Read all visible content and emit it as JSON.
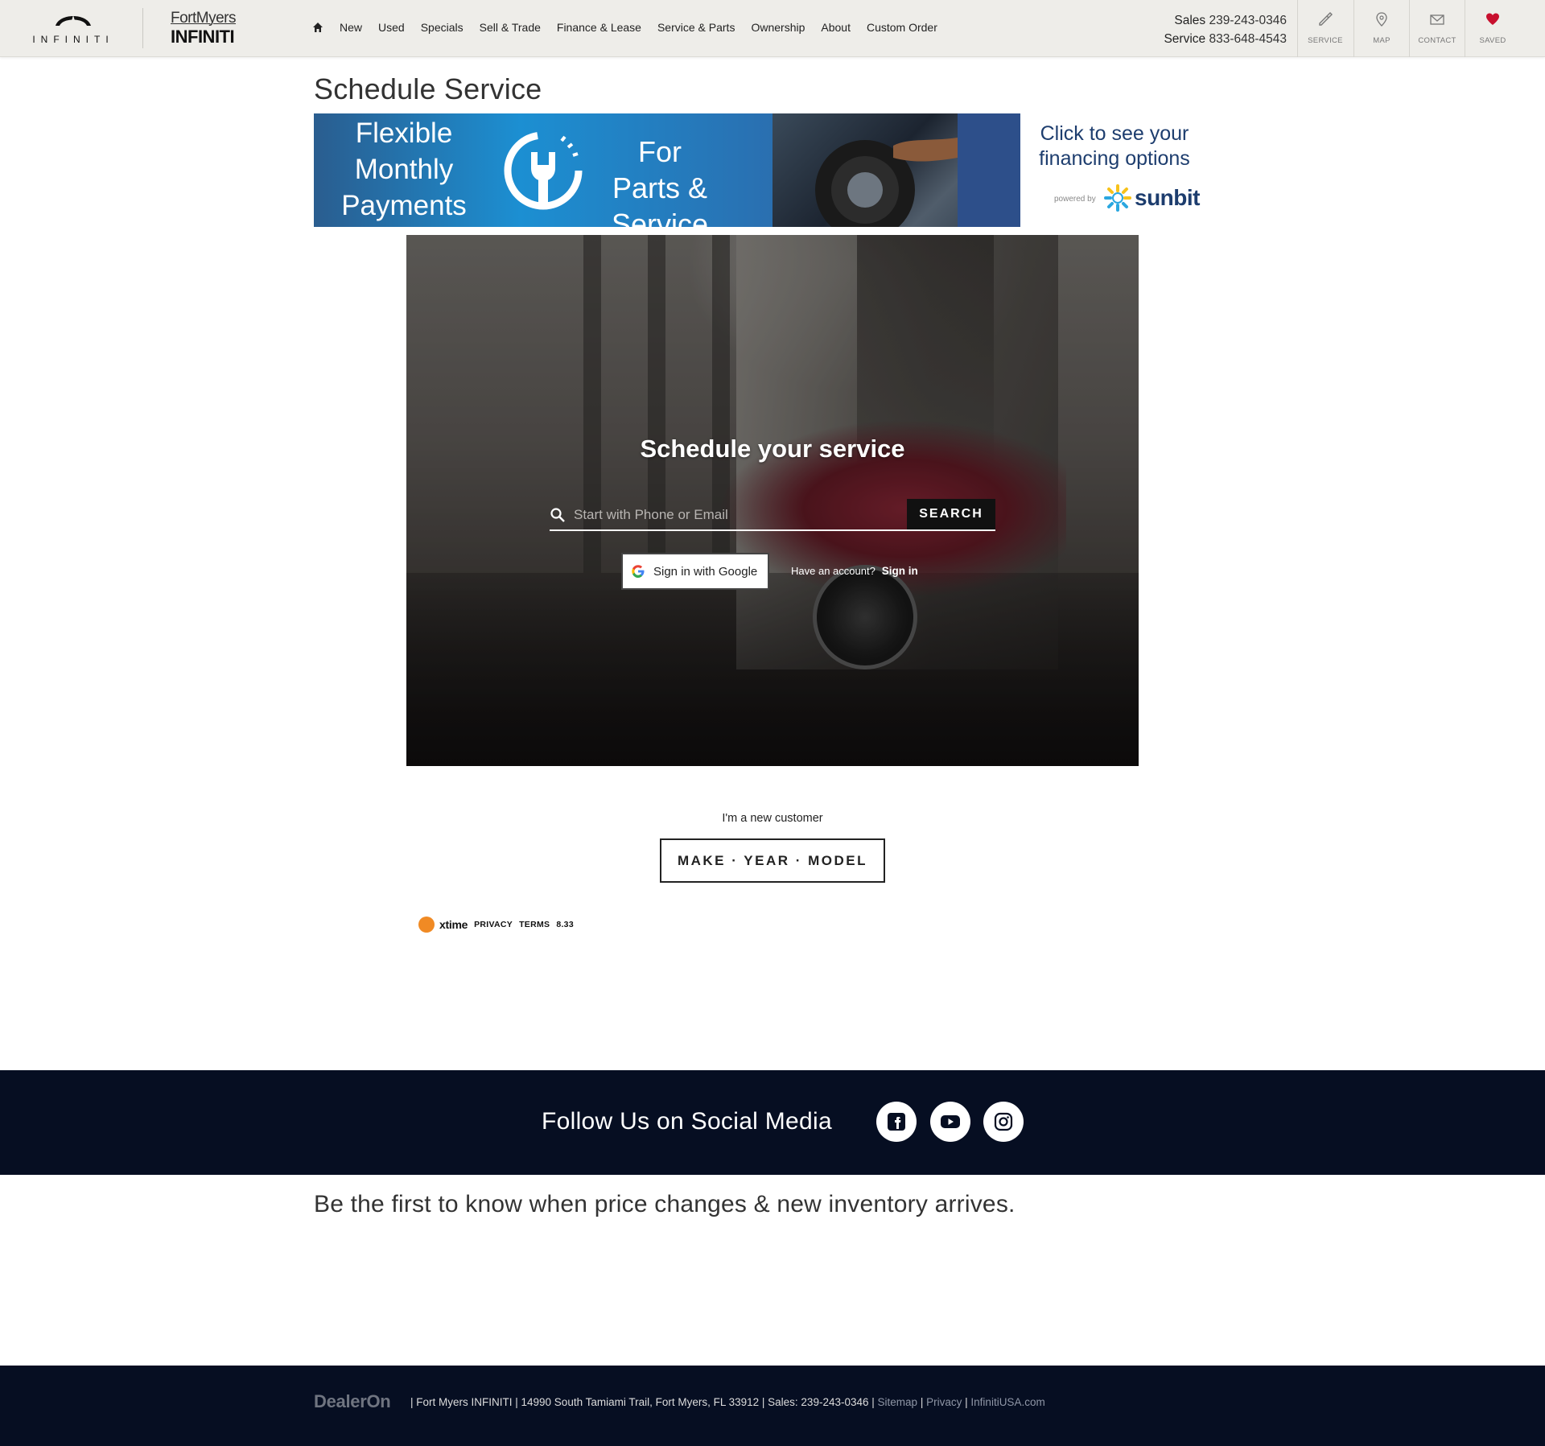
{
  "header": {
    "brand_word": "INFINITI",
    "dealer_line1": "FortMyers",
    "dealer_line2": "INFINITI",
    "nav": [
      "New",
      "Used",
      "Specials",
      "Sell & Trade",
      "Finance & Lease",
      "Service & Parts",
      "Ownership",
      "About",
      "Custom Order"
    ],
    "sales_label": "Sales",
    "sales_phone": "239-243-0346",
    "service_label": "Service",
    "service_phone": "833-648-4543",
    "utility": {
      "service": "SERVICE",
      "map": "MAP",
      "contact": "CONTACT",
      "saved": "SAVED"
    },
    "saved_color": "#c8102e"
  },
  "page": {
    "title": "Schedule Service"
  },
  "banner": {
    "left_text": "Flexible Monthly Payments",
    "mid_text": "For Parts & Service",
    "right_text": "Click to see your financing options",
    "powered_by": "powered by",
    "brand": "sunbit"
  },
  "scheduler": {
    "title": "Schedule your service",
    "search_placeholder": "Start with Phone or Email",
    "search_button": "SEARCH",
    "google_button": "Sign in with Google",
    "have_account": "Have an account?",
    "sign_in": "Sign in",
    "new_customer": "I'm a new customer",
    "make_year_model": "MAKE · YEAR · MODEL",
    "xtime": "xtime",
    "privacy": "PRIVACY",
    "terms": "TERMS",
    "version": "8.33"
  },
  "social": {
    "title": "Follow Us on Social Media",
    "icons": [
      "facebook-icon",
      "youtube-icon",
      "instagram-icon"
    ]
  },
  "newsletter": {
    "message": "Be the first to know when price changes & new inventory arrives."
  },
  "footer": {
    "logo": "DealerOn",
    "info": "| Fort Myers INFINITI | 14990 South Tamiami Trail, Fort Myers, FL 33912 | Sales: 239-243-0346 |",
    "sitemap": "Sitemap",
    "sep": "|",
    "privacy": "Privacy",
    "infiniti_usa": "InfinitiUSA.com"
  }
}
